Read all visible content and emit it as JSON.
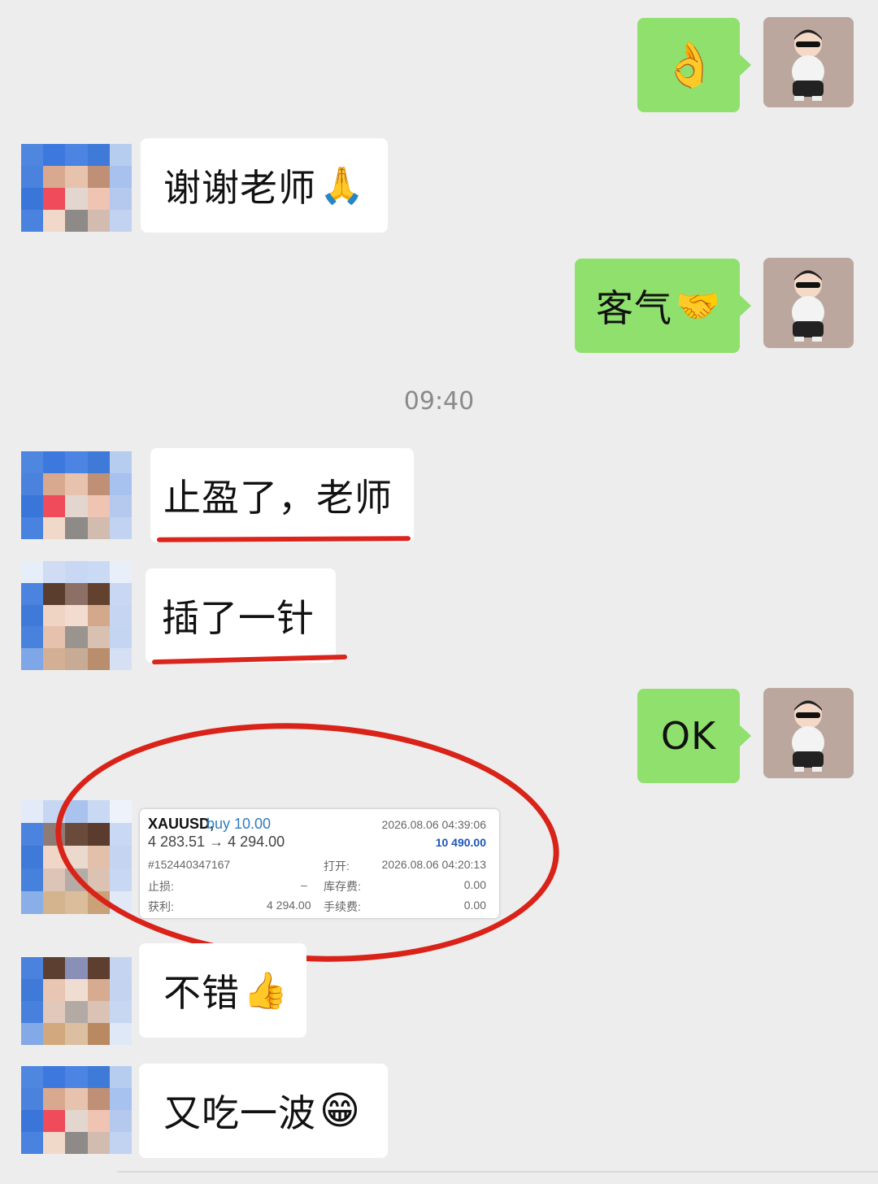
{
  "chat": {
    "timestamp": "09:40",
    "messages": [
      {
        "side": "right",
        "text": "",
        "emoji": "👌"
      },
      {
        "side": "left",
        "text": "谢谢老师",
        "emoji": "🙏"
      },
      {
        "side": "right",
        "text": "客气",
        "emoji": "🤝"
      },
      {
        "side": "left",
        "text": "止盈了，老师",
        "emoji": ""
      },
      {
        "side": "left",
        "text": "插了一针",
        "emoji": ""
      },
      {
        "side": "right",
        "text": "OK",
        "emoji": ""
      },
      {
        "side": "left",
        "text": "不错",
        "emoji": "👍"
      },
      {
        "side": "left",
        "text": "又吃一波",
        "emoji": "😁"
      }
    ]
  },
  "trade": {
    "symbol": "XAUUSD,",
    "direction": "buy 10.00",
    "prices": "4 283.51 → 4 294.00",
    "close_time": "2026.08.06 04:39:06",
    "profit_value": "10 490.00",
    "order_id": "#152440347167",
    "open_label": "打开:",
    "open_time": "2026.08.06 04:20:13",
    "sl_label": "止损:",
    "sl_value": "–",
    "swap_label": "库存费:",
    "swap_value": "0.00",
    "tp_label": "获利:",
    "tp_value": "4 294.00",
    "fee_label": "手续费:",
    "fee_value": "0.00"
  },
  "colors": {
    "background": "#ededed",
    "bubble_self": "#8fe06d",
    "bubble_other": "#ffffff",
    "annotation_red": "#d9251c"
  }
}
